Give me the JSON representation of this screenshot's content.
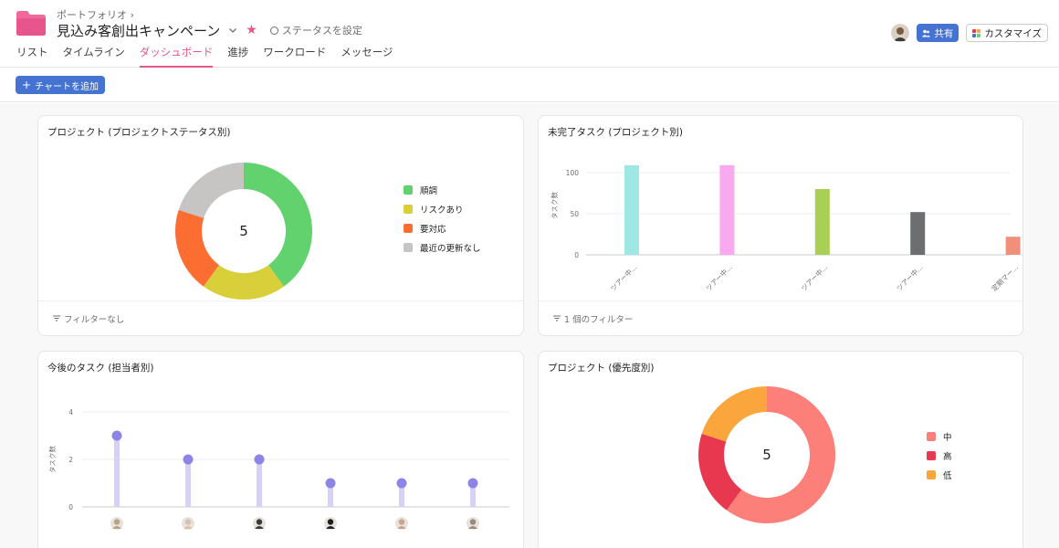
{
  "header": {
    "breadcrumb": "ポートフォリオ ›",
    "title": "見込み客創出キャンペーン",
    "status": "ステータスを設定",
    "share_label": "共有",
    "customize_label": "カスタマイズ"
  },
  "tabs": [
    {
      "label": "リスト"
    },
    {
      "label": "タイムライン"
    },
    {
      "label": "ダッシュボード",
      "active": true
    },
    {
      "label": "進捗"
    },
    {
      "label": "ワークロード"
    },
    {
      "label": "メッセージ"
    }
  ],
  "toolbar": {
    "add_chart_label": "チャートを追加"
  },
  "colors": {
    "accent": "#e8548c",
    "primary_button": "#4573d2"
  },
  "cards": {
    "status_donut": {
      "title": "プロジェクト (プロジェクトステータス別)",
      "footer": "フィルターなし"
    },
    "incomplete_tasks": {
      "title": "未完了タスク (プロジェクト別)",
      "footer": "1 個のフィルター"
    },
    "upcoming_tasks": {
      "title": "今後のタスク (担当者別)"
    },
    "priority_donut": {
      "title": "プロジェクト (優先度別)"
    }
  },
  "chart_data": [
    {
      "type": "pie",
      "title": "プロジェクト (プロジェクトステータス別)",
      "center_label": "5",
      "slices": [
        {
          "label": "順調",
          "value": 2,
          "color": "#62d26f"
        },
        {
          "label": "リスクあり",
          "value": 1,
          "color": "#d8cf3a"
        },
        {
          "label": "要対応",
          "value": 1,
          "color": "#fc6d32"
        },
        {
          "label": "最近の更新なし",
          "value": 1,
          "color": "#c7c4c4"
        }
      ]
    },
    {
      "type": "bar",
      "title": "未完了タスク (プロジェクト別)",
      "ylabel": "タスク数",
      "ylim": [
        0,
        120
      ],
      "yticks": [
        0,
        50,
        100
      ],
      "categories": [
        "ツアー中...",
        "ツアー中...",
        "ツアー中...",
        "ツアー中...",
        "定期マー..."
      ],
      "values": [
        109,
        109,
        80,
        52,
        22
      ],
      "colors": [
        "#9ee7e3",
        "#f9aaef",
        "#a9cf55",
        "#6d6e6f",
        "#f1907a"
      ]
    },
    {
      "type": "scatter",
      "title": "今後のタスク (担当者別)",
      "ylabel": "タスク数",
      "ylim": [
        0,
        4
      ],
      "yticks": [
        0,
        2,
        4
      ],
      "categories": [
        "担当者1",
        "担当者2",
        "担当者3",
        "担当者4",
        "担当者5",
        "担当者6"
      ],
      "values": [
        3,
        2,
        2,
        1,
        1,
        1
      ],
      "point_color": "#8d84e8",
      "stem_color": "#d6d2f7"
    },
    {
      "type": "pie",
      "title": "プロジェクト (優先度別)",
      "center_label": "5",
      "slices": [
        {
          "label": "中",
          "value": 3,
          "color": "#fc7f7a"
        },
        {
          "label": "高",
          "value": 1,
          "color": "#e8384f"
        },
        {
          "label": "低",
          "value": 1,
          "color": "#fba63c"
        }
      ]
    }
  ]
}
